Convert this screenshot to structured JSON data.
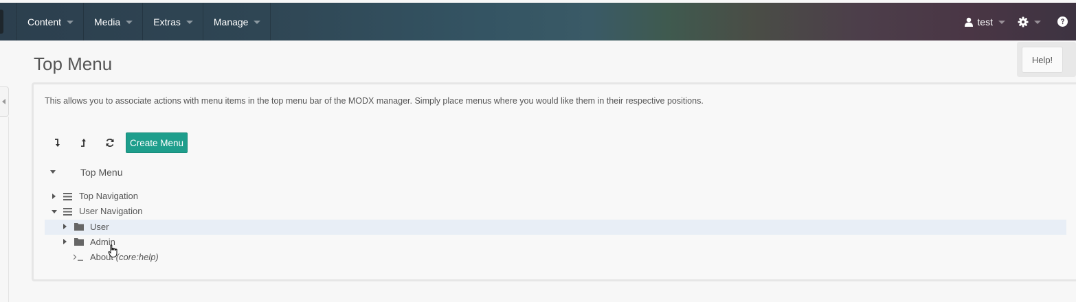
{
  "header": {
    "nav": [
      {
        "label": "Content"
      },
      {
        "label": "Media"
      },
      {
        "label": "Extras"
      },
      {
        "label": "Manage"
      }
    ],
    "user": {
      "name": "test",
      "icon": "user-icon"
    },
    "settings_icon": "gear-icon",
    "help_icon": "question-circle-icon"
  },
  "page": {
    "title": "Top Menu",
    "help_button": "Help!",
    "intro": "This allows you to associate actions with menu items in the top menu bar of the MODX manager. Simply place menus where you would like them in their respective positions."
  },
  "toolbar": {
    "expand_icon": "expand-all-icon",
    "collapse_icon": "collapse-all-icon",
    "refresh_icon": "refresh-icon",
    "create_label": "Create Menu"
  },
  "tree": {
    "root": {
      "label": "Top Menu",
      "expanded": true
    },
    "nodes": [
      {
        "label": "Top Navigation",
        "icon": "list-icon",
        "expanded": false
      },
      {
        "label": "User Navigation",
        "icon": "list-icon",
        "expanded": true
      },
      {
        "label": "User",
        "icon": "folder-icon",
        "expanded": false,
        "selected": true
      },
      {
        "label": "Admin",
        "icon": "folder-icon",
        "expanded": false
      },
      {
        "label": "About",
        "action": "(core:help)",
        "icon": "terminal-icon"
      }
    ]
  },
  "colors": {
    "primary_button": "#1e9e8c",
    "selected_row": "#e8eef6",
    "text": "#555555"
  }
}
